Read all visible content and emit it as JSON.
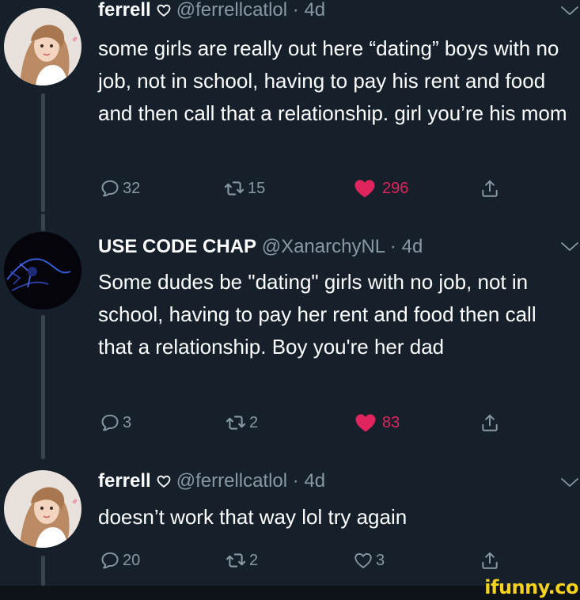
{
  "colors": {
    "background": "#15202b",
    "secondary_text": "#8899a6",
    "like_red": "#e0245e",
    "thread_line": "#38444d",
    "watermark_yellow": "#f5d21b"
  },
  "tweets": [
    {
      "name": "ferrell",
      "name_badge_icon": "heart-outline-icon",
      "handle": "@ferrellcatlol",
      "separator": "·",
      "time": "4d",
      "text": "some girls are really out here “dating” boys with no job, not in school, having to pay his rent and food and then call that a relationship. girl you’re his mom",
      "replies": "32",
      "retweets": "15",
      "likes": "296",
      "liked": true
    },
    {
      "name": "USE CODE CHAP",
      "handle": "@XanarchyNL",
      "separator": "·",
      "time": "4d",
      "text": "Some dudes be \"dating\" girls with no job, not in school, having to pay her rent and food then call that a relationship. Boy you're her dad",
      "replies": "3",
      "retweets": "2",
      "likes": "83",
      "liked": true
    },
    {
      "name": "ferrell",
      "name_badge_icon": "heart-outline-icon",
      "handle": "@ferrellcatlol",
      "separator": "·",
      "time": "4d",
      "text": "doesn’t work that way lol try again",
      "replies": "20",
      "retweets": "2",
      "likes": "3",
      "liked": false
    }
  ],
  "watermark": "ifunny.co"
}
